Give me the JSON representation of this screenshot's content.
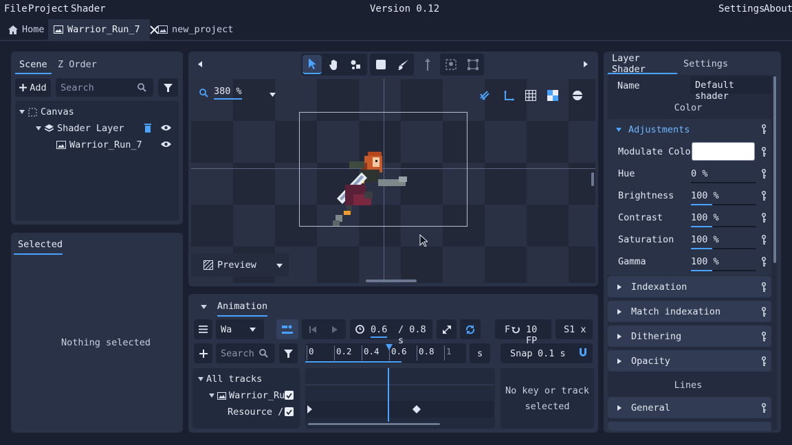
{
  "menu": {
    "file": "File",
    "project": "Project",
    "shader": "Shader",
    "version": "Version 0.12",
    "settings": "Settings",
    "about": "About"
  },
  "tabs": [
    {
      "label": "Home"
    },
    {
      "label": "Warrior_Run_7"
    },
    {
      "label": "new_project"
    }
  ],
  "scene": {
    "tab_scene": "Scene",
    "tab_zorder": "Z Order",
    "add_label": "Add",
    "search_placeholder": "Search",
    "tree": {
      "canvas": "Canvas",
      "shader_layer": "Shader Layer",
      "warrior": "Warrior_Run_7"
    }
  },
  "selected": {
    "title": "Selected",
    "empty": "Nothing selected"
  },
  "viewport": {
    "zoom": "380 %",
    "preview": "Preview"
  },
  "animation": {
    "title": "Animation",
    "track_dropdown": "Wa",
    "current_time": "0.6",
    "total_time": "/ 0.8 s",
    "fps_prefix": "F",
    "fps_value": "10 FP",
    "speed": "S1 x",
    "search_placeholder": "Search",
    "ruler": [
      "0",
      "0.2",
      "0.4",
      "0.6",
      "0.8",
      "1"
    ],
    "ruler_unit": "s",
    "snap_label": "Snap",
    "snap_value": "0.1 s",
    "tracks": {
      "all": "All tracks",
      "warrior": "Warrior_Ru",
      "resource": "Resource /"
    },
    "no_key": "No key or track selected"
  },
  "shader_panel": {
    "tab_layer_shader": "Layer Shader",
    "tab_settings": "Settings",
    "name_label": "Name",
    "name_value": "Default shader",
    "color_header": "Color",
    "adjustments": "Adjustments",
    "params": [
      {
        "label": "Modulate Color",
        "value": ""
      },
      {
        "label": "Hue",
        "value": "0 %",
        "fill": 0
      },
      {
        "label": "Brightness",
        "value": "100 %",
        "fill": 0.33
      },
      {
        "label": "Contrast",
        "value": "100 %",
        "fill": 0.33
      },
      {
        "label": "Saturation",
        "value": "100 %",
        "fill": 0.33
      },
      {
        "label": "Gamma",
        "value": "100 %",
        "fill": 0.33
      }
    ],
    "sections": [
      "Indexation",
      "Match indexation",
      "Dithering",
      "Opacity"
    ],
    "lines_header": "Lines",
    "lines_sections": [
      "General"
    ]
  },
  "colors": {
    "accent": "#4aa3ff",
    "panel": "#2a3248",
    "background": "#1b2030"
  }
}
